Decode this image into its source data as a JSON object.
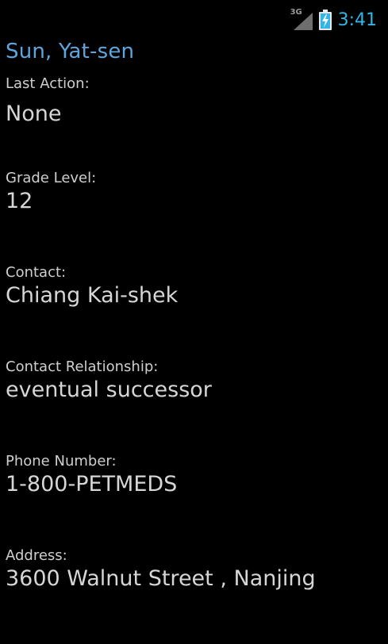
{
  "status_bar": {
    "network_type": "3G",
    "signal_icon": "signal-strength-icon",
    "battery_icon": "battery-charging-icon",
    "time": "3:41",
    "clock_color": "#33b5e5"
  },
  "header": {
    "student_name": "Sun, Yat-sen",
    "name_color": "#5ea6dd"
  },
  "fields": [
    {
      "label": "Last Action:",
      "value": "None"
    },
    {
      "label": "Grade Level:",
      "value": "12"
    },
    {
      "label": "Contact:",
      "value": "Chiang Kai-shek"
    },
    {
      "label": "Contact Relationship:",
      "value": "eventual successor"
    },
    {
      "label": "Phone Number:",
      "value": "1-800-PETMEDS"
    },
    {
      "label": "Address:",
      "value": "3600 Walnut Street , Nanjing"
    }
  ]
}
